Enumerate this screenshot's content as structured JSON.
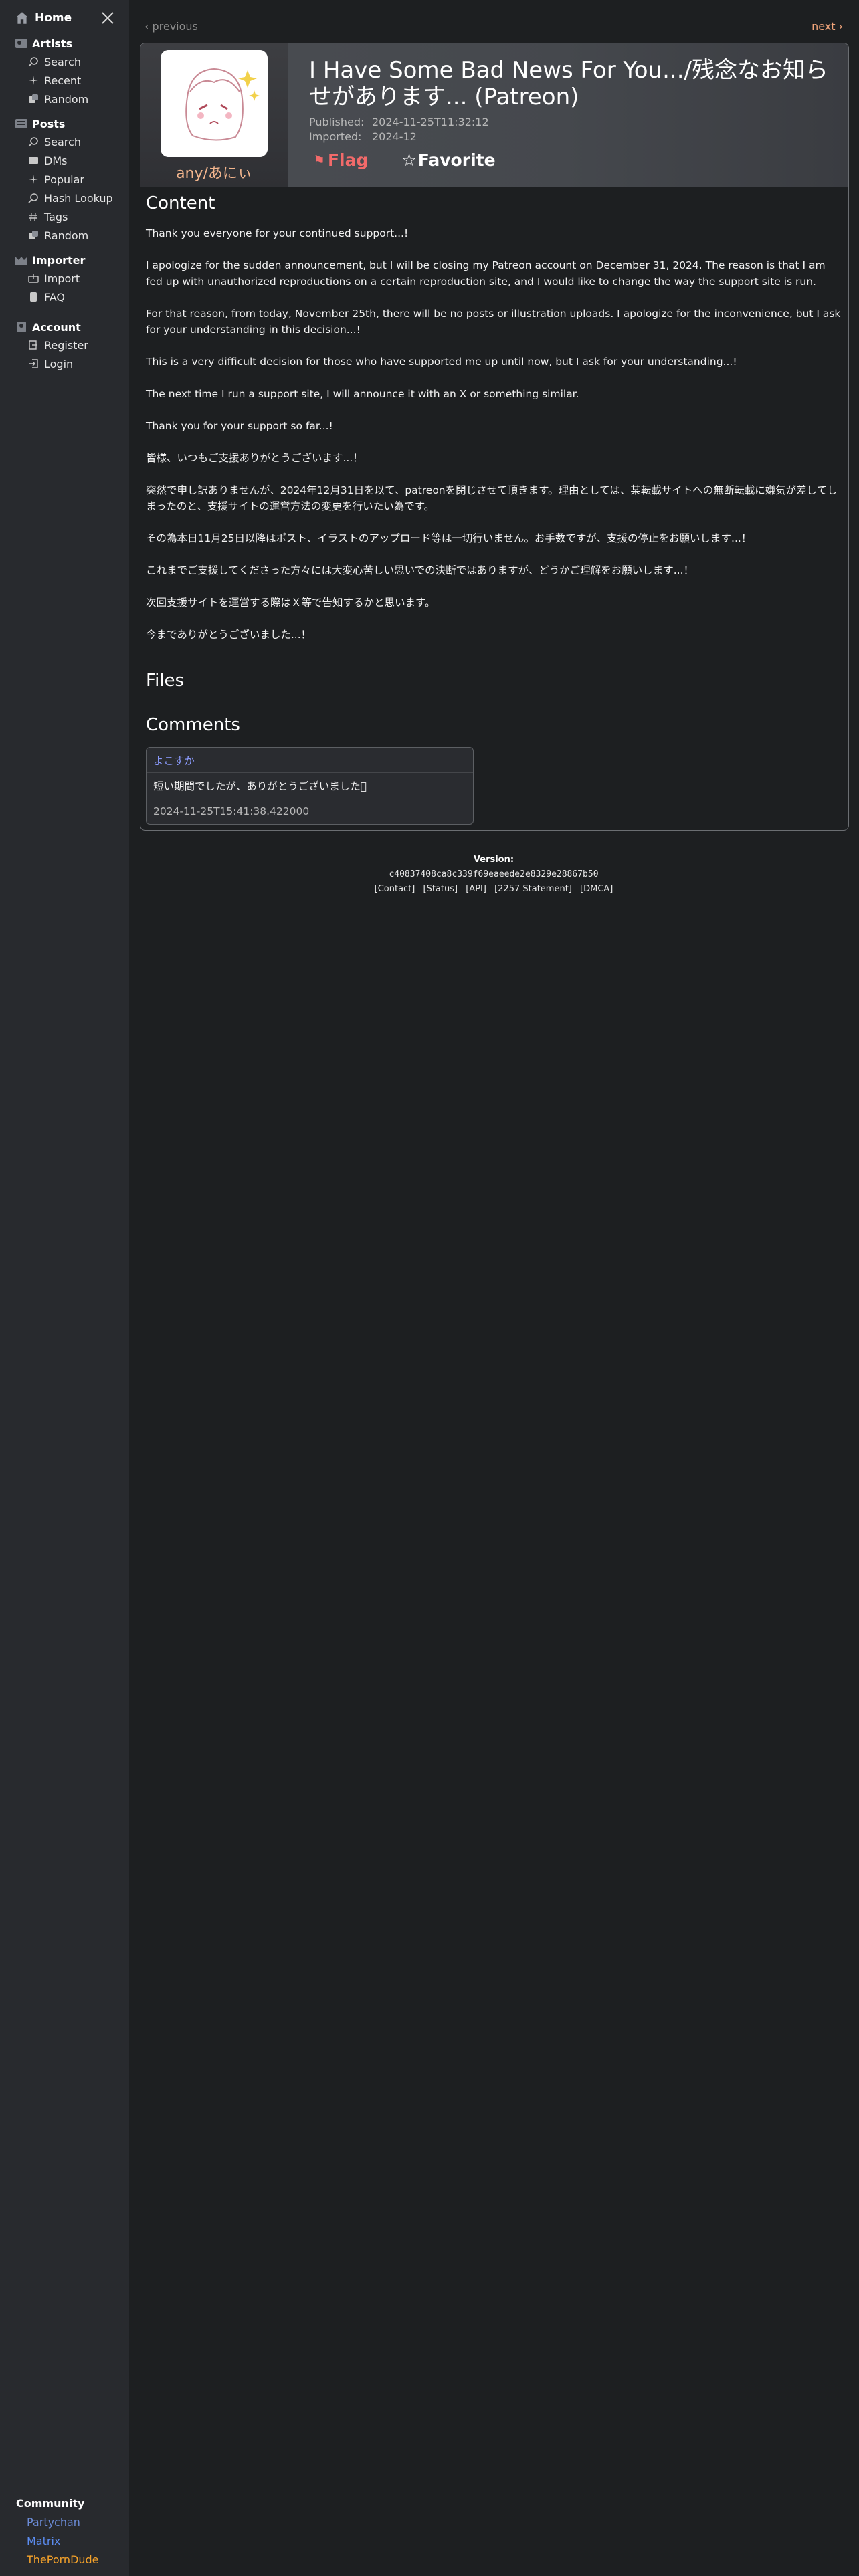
{
  "sidebar": {
    "home": "Home",
    "sections": [
      {
        "title": "Artists",
        "items": [
          "Search",
          "Recent",
          "Random"
        ]
      },
      {
        "title": "Posts",
        "items": [
          "Search",
          "DMs",
          "Popular",
          "Hash Lookup",
          "Tags",
          "Random"
        ]
      },
      {
        "title": "Importer",
        "items": [
          "Import",
          "FAQ"
        ]
      },
      {
        "title": "Account",
        "items": [
          "Register",
          "Login"
        ]
      }
    ],
    "community": {
      "title": "Community",
      "links": [
        {
          "label": "Partychan",
          "color": "#6b8bd6"
        },
        {
          "label": "Matrix",
          "color": "#5b8cf0"
        },
        {
          "label": "ThePornDude",
          "color": "#f5a22a"
        }
      ]
    }
  },
  "nav": {
    "previous": "‹ previous",
    "next": "next ›"
  },
  "post": {
    "artist": "any/あにぃ",
    "title": "I Have Some Bad News For You.../残念なお知らせがあります... (Patreon)",
    "published_label": "Published:",
    "published": "2024-11-25T11:32:12",
    "imported_label": "Imported:",
    "imported": "2024-12",
    "flag": "Flag",
    "favorite": "Favorite",
    "content_title": "Content",
    "paragraphs": [
      "Thank you everyone for your continued support...!",
      "I apologize for the sudden announcement, but I will be closing my Patreon account on December 31, 2024. The reason is that I am fed up with unauthorized reproductions on a certain reproduction site, and I would like to change the way the support site is run.",
      "For that reason, from today, November 25th, there will be no posts or illustration uploads. I apologize for the inconvenience, but I ask for your understanding in this decision...!",
      "This is a very difficult decision for those who have supported me up until now, but I ask for your understanding...!",
      "The next time I run a support site, I will announce it with an X or something similar.",
      "Thank you for your support so far...!",
      "皆様、いつもご支援ありがとうございます...！",
      "突然で申し訳ありませんが、2024年12月31日を以て、patreonを閉じさせて頂きます。理由としては、某転載サイトへの無断転載に嫌気が差してしまったのと、支援サイトの運営方法の変更を行いたい為です。",
      "その為本日11月25日以降はポスト、イラストのアップロード等は一切行いません。お手数ですが、支援の停止をお願いします...！",
      "これまでご支援してくださった方々には大変心苦しい思いでの決断ではありますが、どうかご理解をお願いします...！",
      "次回支援サイトを運営する際はＸ等で告知するかと思います。",
      "今までありがとうございました...！"
    ],
    "files_title": "Files",
    "comments_title": "Comments",
    "comment": {
      "author": "よこすか",
      "body": "短い期間でしたが、ありがとうございました􏰀",
      "time": "2024-11-25T15:41:38.422000"
    }
  },
  "footer": {
    "version_label": "Version:",
    "hash": "c40837408ca8c339f69eaeede2e8329e28867b50",
    "links": [
      "[Contact]",
      "[Status]",
      "[API]",
      "[2257 Statement]",
      "[DMCA]"
    ]
  }
}
